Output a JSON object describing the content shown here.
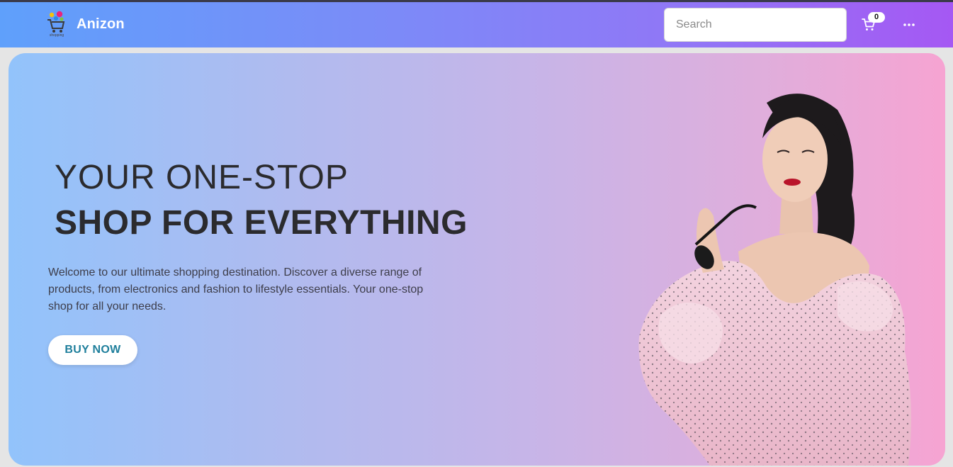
{
  "app": {
    "brand": "Anizon",
    "logo_caption": "shopping"
  },
  "search": {
    "placeholder": "Search",
    "value": ""
  },
  "cart": {
    "count": "0"
  },
  "icons": {
    "cart": "cart-icon",
    "more": "more-horizontal-icon",
    "logo": "shopping-cart-logo"
  },
  "hero": {
    "headline_line1": "YOUR ONE-STOP",
    "headline_line2": "SHOP FOR EVERYTHING",
    "description": "Welcome to our ultimate shopping destination. Discover a diverse range of products, from electronics and fashion to lifestyle essentials. Your one-stop shop for all your needs.",
    "cta_label": "BUY NOW"
  },
  "colors": {
    "nav_start": "#5fa0fb",
    "nav_end": "#a558f3",
    "hero_start": "#92c3fb",
    "hero_end": "#f6a4d2",
    "cta_text": "#1f7f9c"
  }
}
